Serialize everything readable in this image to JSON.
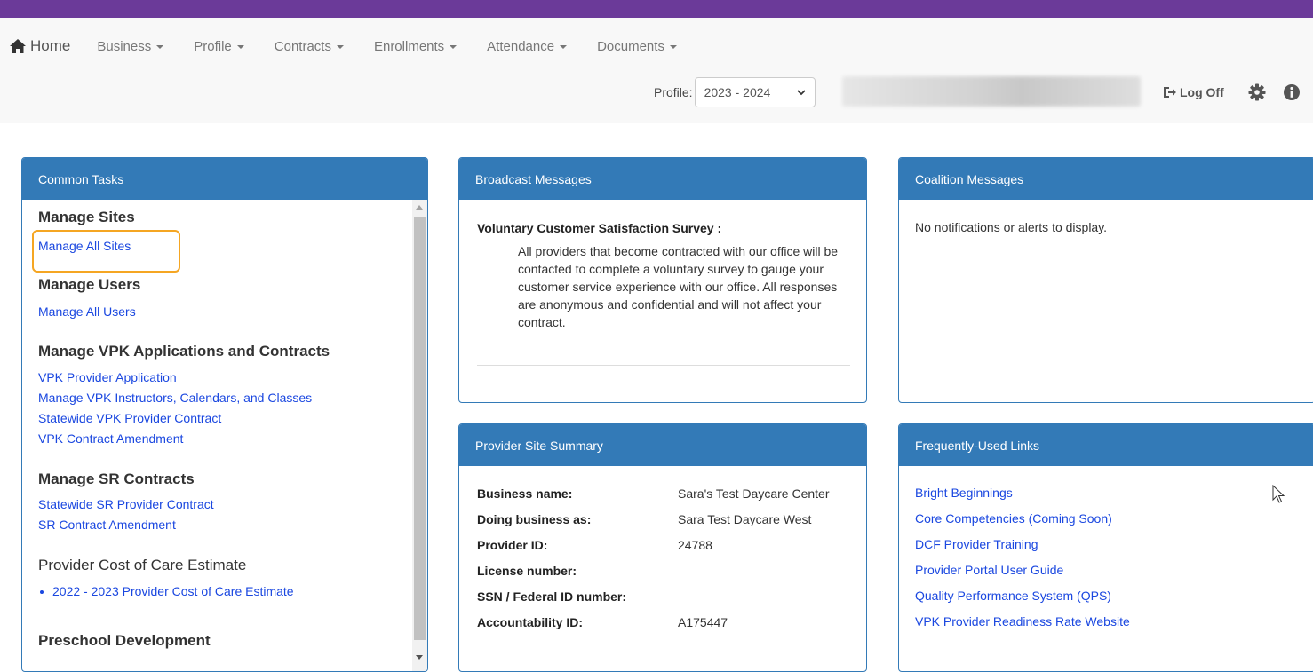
{
  "nav": {
    "home": "Home",
    "items": [
      "Business",
      "Profile",
      "Contracts",
      "Enrollments",
      "Attendance",
      "Documents"
    ],
    "profile_label": "Profile:",
    "profile_value": "2023 - 2024",
    "logoff": "Log Off"
  },
  "common_tasks": {
    "title": "Common Tasks",
    "manage_sites": "Manage Sites",
    "manage_all_sites": "Manage All Sites",
    "manage_users": "Manage Users",
    "manage_all_users": "Manage All Users",
    "vpk_title": "Manage VPK Applications and Contracts",
    "vpk_links": [
      "VPK Provider Application",
      "Manage VPK Instructors, Calendars, and Classes",
      "Statewide VPK Provider Contract",
      "VPK Contract Amendment"
    ],
    "sr_title": "Manage SR Contracts",
    "sr_links": [
      "Statewide SR Provider Contract",
      "SR Contract Amendment"
    ],
    "cost_title": "Provider Cost of Care Estimate",
    "cost_link": "2022 - 2023 Provider Cost of Care Estimate",
    "preschool_title": "Preschool Development"
  },
  "broadcast": {
    "title": "Broadcast Messages",
    "msg_title": "Voluntary Customer Satisfaction Survey :",
    "msg_body": "All providers that become contracted with our office will be contacted to complete a voluntary survey to gauge your customer service experience with our office. All responses are anonymous and confidential and will not affect your contract."
  },
  "coalition": {
    "title": "Coalition Messages",
    "empty": "No notifications or alerts to display."
  },
  "summary": {
    "title": "Provider Site Summary",
    "rows": [
      {
        "label": "Business name:",
        "value": "Sara's Test Daycare Center"
      },
      {
        "label": "Doing business as:",
        "value": "Sara Test Daycare West"
      },
      {
        "label": "Provider ID:",
        "value": "24788"
      },
      {
        "label": "License number:",
        "value": ""
      },
      {
        "label": "SSN / Federal ID number:",
        "value": ""
      },
      {
        "label": "Accountability ID:",
        "value": "A175447"
      }
    ]
  },
  "frequent": {
    "title": "Frequently-Used Links",
    "links": [
      "Bright Beginnings",
      "Core Competencies (Coming Soon)",
      "DCF Provider Training",
      "Provider Portal User Guide",
      "Quality Performance System (QPS)",
      "VPK Provider Readiness Rate Website"
    ]
  }
}
